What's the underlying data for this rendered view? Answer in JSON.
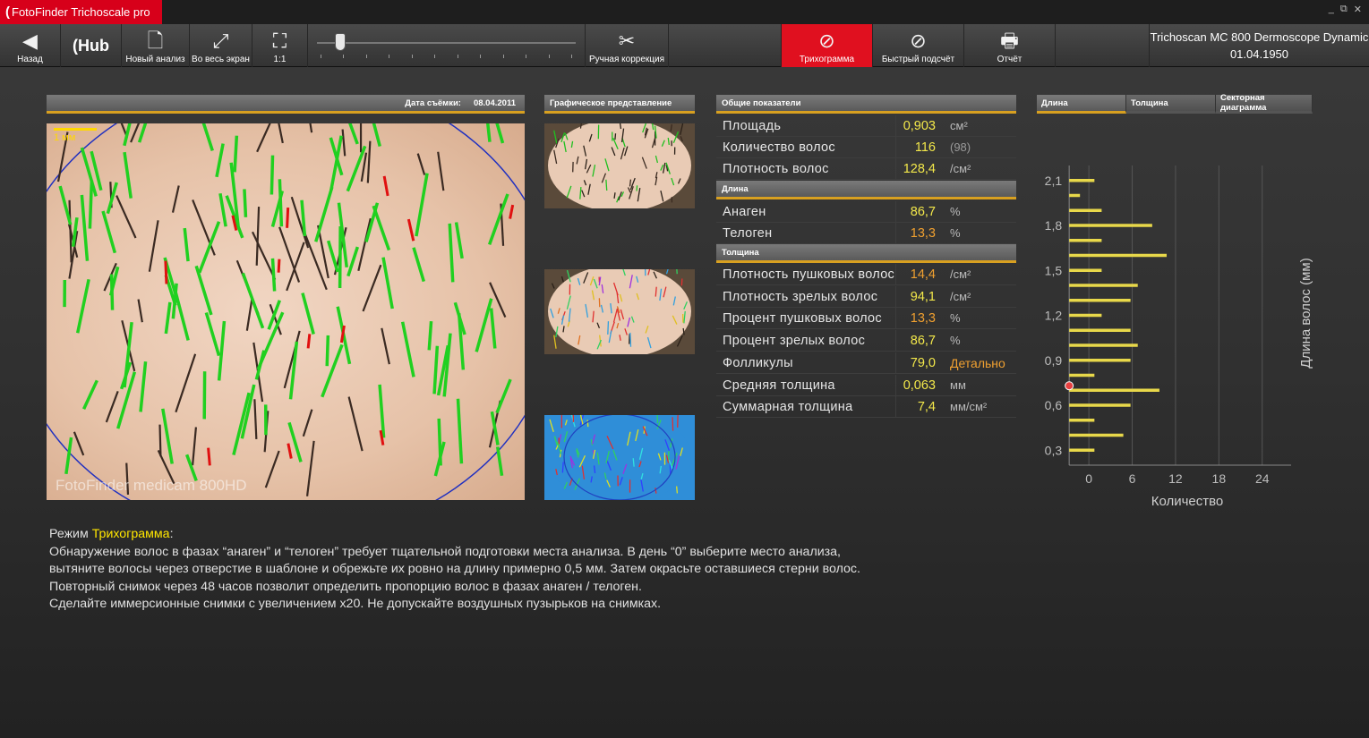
{
  "window": {
    "app_title": "FotoFinder Trichoscale pro",
    "controls": [
      "_",
      "⧉",
      "✕"
    ]
  },
  "toolbar": {
    "back_label": "Назад",
    "hub_label": "Hub",
    "new_analysis_label": "Новый анализ",
    "fullscreen_label": "Во весь экран",
    "one_to_one_label": "1:1",
    "manual_correction_label": "Ручная коррекция",
    "trichogram_label": "Трихограмма",
    "quick_count_label": "Быстрый подсчёт",
    "report_label": "Отчёт",
    "device_name": "Trichoscan MC 800 Dermoscope Dynamic",
    "patient_date": "01.04.1950",
    "accent_color": "#e0101f"
  },
  "image_panel": {
    "date_label": "Дата съёмки:",
    "date_value": "08.04.2011",
    "scale_label": "1 мм",
    "camera_label": "FotoFinder medicam 800HD"
  },
  "graphic_panel": {
    "header": "Графическое представление"
  },
  "stats": {
    "general_header": "Общие показатели",
    "area_label": "Площадь",
    "area_value": "0,903",
    "area_unit": "см²",
    "hair_count_label": "Количество волос",
    "hair_count_value": "116",
    "hair_count_total": "(98)",
    "density_label": "Плотность волос",
    "density_value": "128,4",
    "density_unit": "/см²",
    "length_header": "Длина",
    "anagen_label": "Анаген",
    "anagen_value": "86,7",
    "anagen_unit": "%",
    "telogen_label": "Телоген",
    "telogen_value": "13,3",
    "telogen_unit": "%",
    "thickness_header": "Толщина",
    "vellus_density_label": "Плотность пушковых волос",
    "vellus_density_value": "14,4",
    "vellus_density_unit": "/см²",
    "terminal_density_label": "Плотность зрелых волос",
    "terminal_density_value": "94,1",
    "terminal_density_unit": "/см²",
    "vellus_pct_label": "Процент пушковых волос",
    "vellus_pct_value": "13,3",
    "vellus_pct_unit": "%",
    "terminal_pct_label": "Процент зрелых волос",
    "terminal_pct_value": "86,7",
    "terminal_pct_unit": "%",
    "follicles_label": "Фолликулы",
    "follicles_value": "79,0",
    "follicles_link": "Детально",
    "mean_thickness_label": "Средняя толщина",
    "mean_thickness_value": "0,063",
    "mean_thickness_unit": "мм",
    "cumulative_thickness_label": "Суммарная толщина",
    "cumulative_thickness_value": "7,4",
    "cumulative_thickness_unit": "мм/см²"
  },
  "tabs": {
    "length": "Длина",
    "thickness": "Толщина",
    "pie": "Секторная диаграмма"
  },
  "chart_data": {
    "type": "bar",
    "orientation": "horizontal",
    "xlabel": "Количество",
    "ylabel": "Длина волос (мм)",
    "xticks": [
      0,
      6,
      12,
      18,
      24
    ],
    "yticks": [
      "0,3",
      "0,6",
      "0,9",
      "1,2",
      "1,5",
      "1,8",
      "2,1"
    ],
    "xlim": [
      -2,
      28
    ],
    "ylim": [
      0.2,
      2.2
    ],
    "bars_y": [
      0.3,
      0.4,
      0.5,
      0.6,
      0.7,
      0.8,
      0.9,
      1.0,
      1.1,
      1.2,
      1.3,
      1.4,
      1.5,
      1.6,
      1.7,
      1.8,
      1.9,
      2.0,
      2.1
    ],
    "bars_x": [
      3,
      7,
      3,
      8,
      12,
      3,
      8,
      9,
      8,
      4,
      8,
      9,
      4,
      13,
      4,
      11,
      4,
      1,
      3
    ],
    "marker_y": 0.73,
    "bar_color": "#e8d84a",
    "marker_color": "#e84040",
    "grid": true
  },
  "info": {
    "mode_prefix": "Режим ",
    "mode_name": "Трихограмма",
    "mode_suffix": ":",
    "line1": "Обнаружение волос в фазах “анаген” и “телоген” требует тщательной подготовки места анализа. В день “0” выберите место анализа,",
    "line2": "вытяните волосы через отверстие в шаблоне и обрежьте их ровно на длину примерно 0,5 мм. Затем окрасьте оставшиеся стерни волос.",
    "line3": "Повторный снимок через 48 часов позволит определить пропорцию волос в фазах анаген / телоген.",
    "line4": "Сделайте иммерсионные снимки с увеличением x20. Не допускайте воздушных пузырьков на снимках."
  }
}
